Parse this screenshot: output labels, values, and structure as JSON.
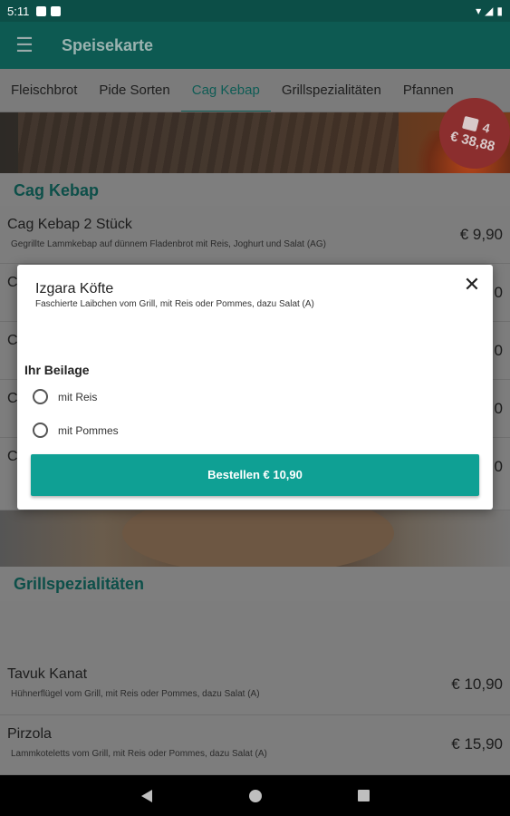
{
  "status_bar": {
    "time": "5:11"
  },
  "app_bar": {
    "title": "Speisekarte",
    "menu_icon": "hamburger-menu-icon"
  },
  "tabs": [
    {
      "label": "Fleischbrot",
      "active": false
    },
    {
      "label": "Pide Sorten",
      "active": false
    },
    {
      "label": "Cag Kebap",
      "active": true
    },
    {
      "label": "Grillspezialitäten",
      "active": false
    },
    {
      "label": "Pfannen",
      "active": false
    }
  ],
  "cart": {
    "count": "4",
    "total": "€ 38,88"
  },
  "sections": {
    "cag_kebap": {
      "title": "Cag Kebap"
    },
    "grill": {
      "title": "Grillspezialitäten"
    }
  },
  "items": {
    "cag_kebap_2": {
      "name": "Cag Kebap 2 Stück",
      "desc": "Gegrillte Lammkebap auf dünnem Fladenbrot mit Reis, Joghurt und Salat (AG)",
      "price": "€ 9,90"
    },
    "partial_1": {
      "name": "C",
      "price": "0"
    },
    "partial_2": {
      "name": "C",
      "price": "0"
    },
    "partial_3": {
      "name": "C",
      "price": "0"
    },
    "partial_4": {
      "name": "C",
      "price": "0"
    },
    "tavuk_kanat": {
      "name": "Tavuk Kanat",
      "desc": "Hühnerflügel vom Grill, mit Reis oder Pommes, dazu Salat (A)",
      "price": "€ 10,90"
    },
    "pirzola": {
      "name": "Pirzola",
      "desc": "Lammkoteletts vom Grill, mit Reis oder Pommes, dazu Salat (A)",
      "price": "€ 15,90"
    }
  },
  "dialog": {
    "title": "Izgara Köfte",
    "description": "Faschierte Laibchen vom Grill, mit Reis oder Pommes, dazu Salat (A)",
    "group_label": "Ihr Beilage",
    "options": [
      "mit Reis",
      "mit Pommes"
    ],
    "order_button": "Bestellen € 10,90"
  },
  "colors": {
    "primary": "#0fa094",
    "app_bar": "#0d5a52",
    "cart_badge": "#8b2e2e"
  }
}
